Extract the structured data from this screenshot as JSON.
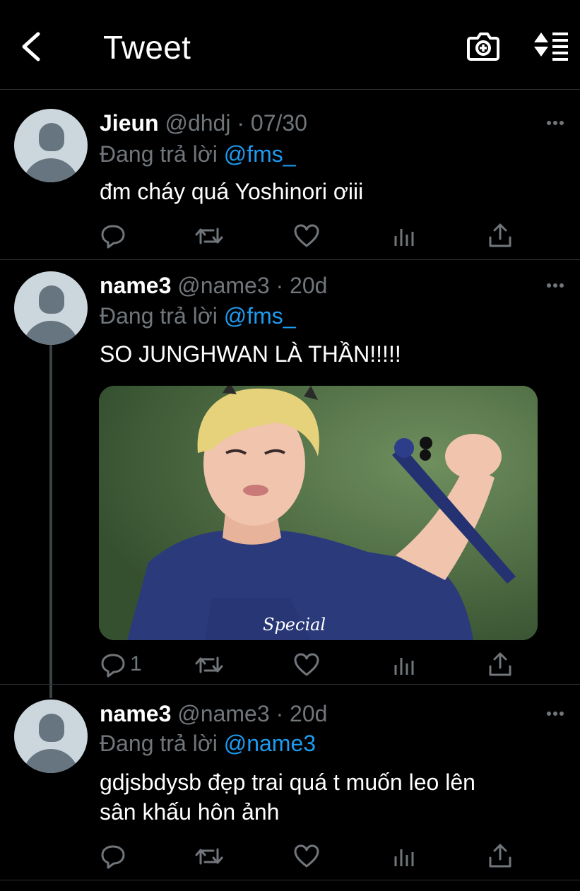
{
  "header": {
    "title": "Tweet"
  },
  "tweets": [
    {
      "name": "Jieun",
      "handle": "@dhdj",
      "time": "07/30",
      "reply_prefix": "Đang trả lời ",
      "reply_to": "@fms_",
      "lines": [
        "đm cháy quá Yoshinori ơiii"
      ],
      "reply_count": ""
    },
    {
      "name": "name3",
      "handle": "@name3",
      "time": "20d",
      "reply_prefix": "Đang trả lời ",
      "reply_to": "@fms_",
      "lines": [
        "SO JUNGHWAN LÀ THẦN!!!!!"
      ],
      "media_caption": "Special",
      "reply_count": "1"
    },
    {
      "name": "name3",
      "handle": "@name3",
      "time": "20d",
      "reply_prefix": "Đang trả lời ",
      "reply_to": "@name3",
      "lines": [
        "gdjsbdysb đẹp trai quá t muốn leo lên",
        "sân khấu hôn ảnh"
      ],
      "reply_count": ""
    }
  ],
  "icons": {
    "back": "chevron-left-icon",
    "camera": "camera-add-icon",
    "sort": "sort-icon",
    "more": "more-icon",
    "reply": "reply-icon",
    "retweet": "retweet-icon",
    "like": "heart-icon",
    "analytics": "analytics-icon",
    "share": "share-icon"
  },
  "colors": {
    "background": "#000000",
    "secondary_text": "#71767b",
    "link": "#1d9bf0",
    "divider": "#2f3336"
  }
}
